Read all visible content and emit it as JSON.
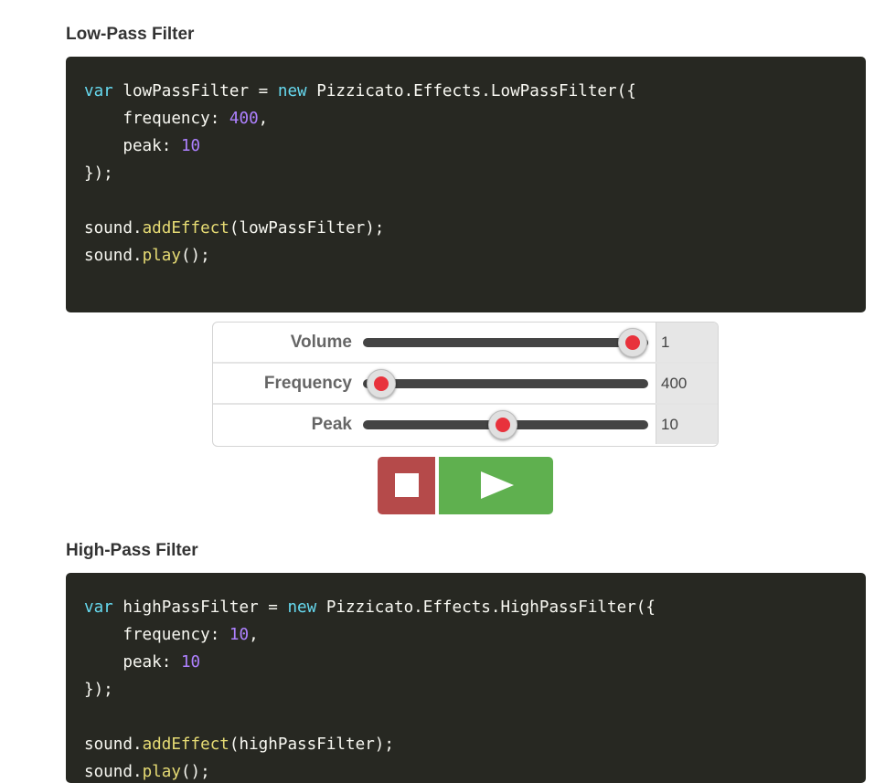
{
  "lowpass": {
    "title": "Low-Pass Filter",
    "code": {
      "l1_kw": "var",
      "l1_a": " lowPassFilter = ",
      "l1_new": "new",
      "l1_b": " Pizzicato.Effects.LowPassFilter({",
      "l2_a": "    frequency: ",
      "l2_num": "400",
      "l2_b": ",",
      "l3_a": "    peak: ",
      "l3_num": "10",
      "l4": "});",
      "l6_a": "sound.",
      "l6_fn": "addEffect",
      "l6_b": "(lowPassFilter);",
      "l7_a": "sound.",
      "l7_fn": "play",
      "l7_b": "();"
    }
  },
  "controls": {
    "volume": {
      "label": "Volume",
      "value": "1",
      "fraction": 0.945
    },
    "frequency": {
      "label": "Frequency",
      "value": "400",
      "fraction": 0.065
    },
    "peak": {
      "label": "Peak",
      "value": "10",
      "fraction": 0.49
    }
  },
  "buttons": {
    "stop_icon": "stop-icon",
    "play_icon": "play-icon",
    "stop_color": "#b54a4a",
    "play_color": "#5fb04f"
  },
  "highpass": {
    "title": "High-Pass Filter",
    "code": {
      "l1_kw": "var",
      "l1_a": " highPassFilter = ",
      "l1_new": "new",
      "l1_b": " Pizzicato.Effects.HighPassFilter({",
      "l2_a": "    frequency: ",
      "l2_num": "10",
      "l2_b": ",",
      "l3_a": "    peak: ",
      "l3_num": "10",
      "l4": "});",
      "l6_a": "sound.",
      "l6_fn": "addEffect",
      "l6_b": "(highPassFilter);",
      "l7_a": "sound.",
      "l7_fn": "play",
      "l7_b": "();"
    }
  },
  "colors": {
    "code_bg": "#272822",
    "keyword": "#66d9ef",
    "number": "#ae81ff",
    "function": "#e6db74",
    "slider_dot": "#e8323c"
  }
}
